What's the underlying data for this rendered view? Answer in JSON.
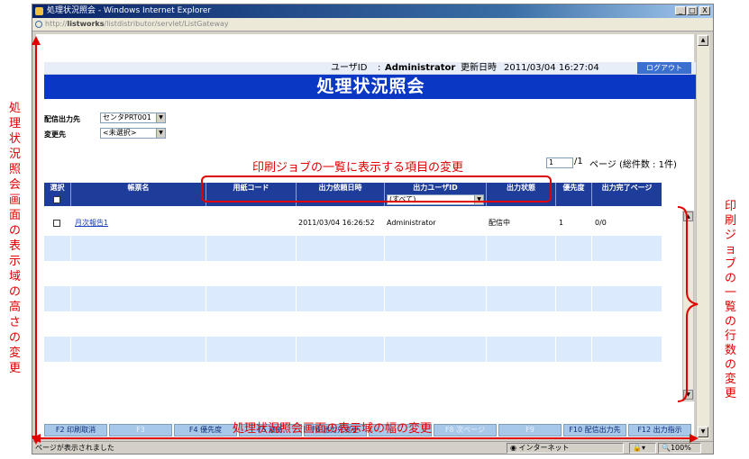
{
  "window": {
    "title": "処理状況照会 - Windows Internet Explorer",
    "address_prefix": "http://",
    "address_host": "listworks",
    "address_path": "/listdistributor/servlet/ListGateway",
    "min_label": "_",
    "max_label": "□",
    "close_label": "X"
  },
  "header": {
    "userid_label": "ユーザID",
    "userid_value": "Administrator",
    "updated_label": "更新日時",
    "updated_value": "2011/03/04 16:27:04",
    "logout": "ログアウト",
    "page_title": "処理状況照会"
  },
  "filters": {
    "dest_label": "配信出力先",
    "dest_value": "センタPRT001",
    "change_label": "変更先",
    "change_value": "<未選択>"
  },
  "pager": {
    "page_input": "1",
    "page_total": "/1",
    "page_suffix": "ページ (総件数 : 1件)"
  },
  "table": {
    "columns": [
      "選択",
      "帳票名",
      "用紙コード",
      "出力依頼日時",
      "出力ユーザID",
      "出力状態",
      "優先度",
      "出力完了ページ"
    ],
    "filter_user": "(すべて)",
    "rows": [
      {
        "report": "月次報告1",
        "paper": "",
        "requested": "2011/03/04 16:26:52",
        "user": "Administrator",
        "status": "配信中",
        "priority": "1",
        "pages": "0/0"
      }
    ]
  },
  "function_keys": [
    {
      "label": "F2  印刷取消",
      "enabled": true
    },
    {
      "label": "F3",
      "enabled": false
    },
    {
      "label": "F4  優先度",
      "enabled": true
    },
    {
      "label": "F5  最新",
      "enabled": true
    },
    {
      "label": "F6  出力先変更",
      "enabled": true
    },
    {
      "label": "F7  前ページ",
      "enabled": false
    },
    {
      "label": "F8  次ページ",
      "enabled": false
    },
    {
      "label": "F9",
      "enabled": false
    },
    {
      "label": "F10  配信出力先",
      "enabled": true
    },
    {
      "label": "F12  出力指示",
      "enabled": true
    }
  ],
  "statusbar": {
    "message": "ページが表示されました",
    "zone": "インターネット",
    "zoom": "100%"
  },
  "annotations": {
    "columns_note": "印刷ジョブの一覧に表示する項目の変更",
    "height_note": "処理状況照会画面の表示域の高さの変更",
    "width_note": "処理状況照会画面の表示域の幅の変更",
    "rows_note": "印刷ジョブの一覧の行数の変更"
  },
  "colors": {
    "banner": "#0a37c4",
    "table_header": "#1e3c9a",
    "annotation": "#e00000",
    "fkey": "#a8c8ea"
  }
}
